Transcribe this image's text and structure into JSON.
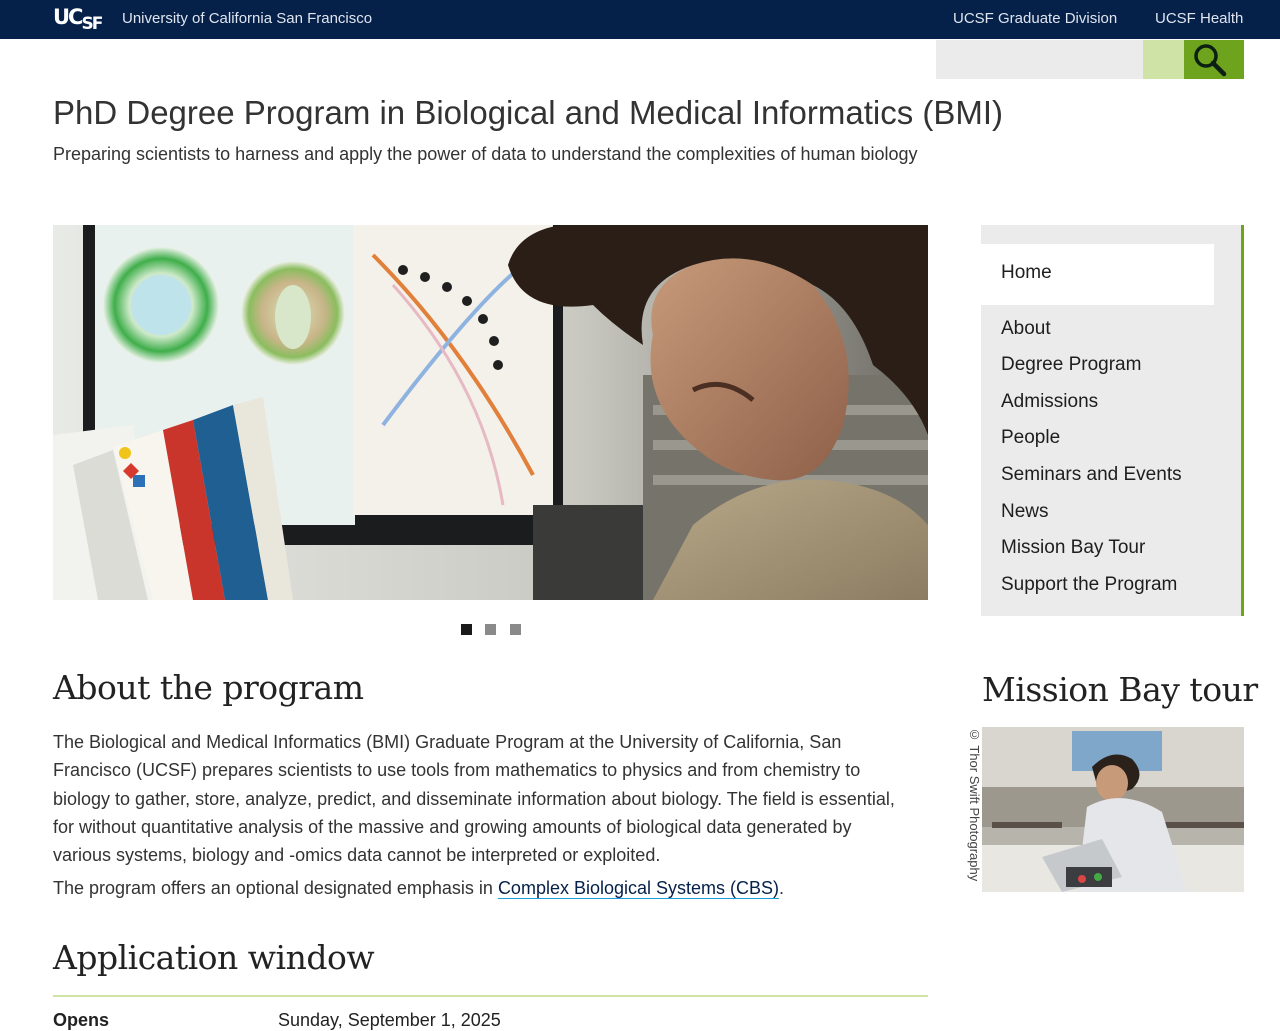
{
  "topbar": {
    "logo_text": "UCSF",
    "university": "University of California San Francisco",
    "links": [
      "UCSF Graduate Division",
      "UCSF Health"
    ]
  },
  "search": {
    "placeholder": "",
    "icon": "search-icon"
  },
  "header": {
    "title": "PhD Degree Program in Biological and Medical Informatics (BMI)",
    "tagline": "Preparing scientists to harness and apply the power of data to understand the complexities of human biology"
  },
  "hero": {
    "slide_count": 3,
    "active_slide": 1
  },
  "sidenav": {
    "items": [
      "Home",
      "About",
      "Degree Program",
      "Admissions",
      "People",
      "Seminars and Events",
      "News",
      "Mission Bay Tour",
      "Support the Program"
    ],
    "active": "Home"
  },
  "about": {
    "heading": "About the program",
    "body": "The Biological and Medical Informatics (BMI) Graduate Program at the University of California, San Francisco (UCSF) prepares scientists to use tools from mathematics to physics and from chemistry to biology to gather, store, analyze, predict, and disseminate information about biology. The field is essential, for without quantitative analysis of the massive and growing amounts of biological data generated by various systems, biology and -omics data cannot be interpreted or exploited.",
    "cbs_prefix": "The program offers an optional designated emphasis in ",
    "cbs_link": "Complex Biological Systems (CBS)",
    "cbs_suffix": "."
  },
  "tour": {
    "heading": "Mission Bay tour",
    "credit": "© Thor Swift Photography"
  },
  "application": {
    "heading": "Application window",
    "opens_label": "Opens",
    "opens_value": "Sunday, September 1, 2025"
  },
  "colors": {
    "topbar": "#052049",
    "accent_green": "#6ea31d",
    "light_green": "#cfe3a7",
    "nav_bg": "#ebebeb"
  }
}
